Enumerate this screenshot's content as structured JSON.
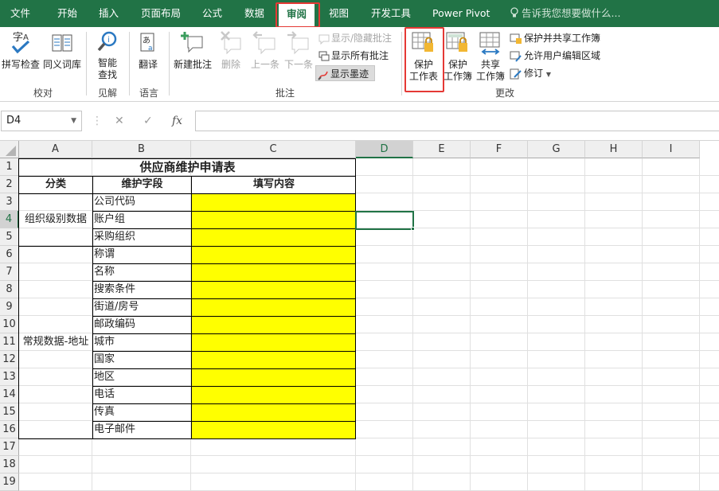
{
  "tabs": [
    "文件",
    "开始",
    "插入",
    "页面布局",
    "公式",
    "数据",
    "审阅",
    "视图",
    "开发工具",
    "Power Pivot"
  ],
  "active_tab": "审阅",
  "tell_me": "告诉我您想要做什么...",
  "ribbon": {
    "spell_check": "拼写检查",
    "thesaurus": "同义词库",
    "smart_lookup_1": "智能",
    "smart_lookup_2": "查找",
    "translate": "翻译",
    "new_comment": "新建批注",
    "delete_comment": "删除",
    "prev_comment": "上一条",
    "next_comment": "下一条",
    "show_hide_comment": "显示/隐藏批注",
    "show_all_comments": "显示所有批注",
    "show_ink": "显示墨迹",
    "protect_sheet_1": "保护",
    "protect_sheet_2": "工作表",
    "protect_workbook_1": "保护",
    "protect_workbook_2": "工作簿",
    "share_workbook_1": "共享",
    "share_workbook_2": "工作簿",
    "protect_share": "保护并共享工作簿",
    "allow_edit_ranges": "允许用户编辑区域",
    "track_changes": "修订",
    "groups": {
      "proofing": "校对",
      "insights": "见解",
      "language": "语言",
      "comments": "批注",
      "changes": "更改"
    }
  },
  "formula_bar": {
    "name_box": "D4",
    "fx": "fx",
    "cancel": "✕",
    "enter": "✓",
    "formula": ""
  },
  "columns": [
    "A",
    "B",
    "C",
    "D",
    "E",
    "F",
    "G",
    "H",
    "I"
  ],
  "selected_cell": "D4",
  "sheet": {
    "title": "供应商维护申请表",
    "header_category": "分类",
    "header_field": "维护字段",
    "header_content": "填写内容",
    "group1": "组织级别数据",
    "group2": "常规数据-地址",
    "fields": [
      "公司代码",
      "账户组",
      "采购组织",
      "称谓",
      "名称",
      "搜索条件",
      "街道/房号",
      "邮政编码",
      "城市",
      "国家",
      "地区",
      "电话",
      "传真",
      "电子邮件"
    ]
  },
  "colors": {
    "brand": "#217346",
    "highlight": "#ffff00",
    "callout": "#e53935"
  }
}
